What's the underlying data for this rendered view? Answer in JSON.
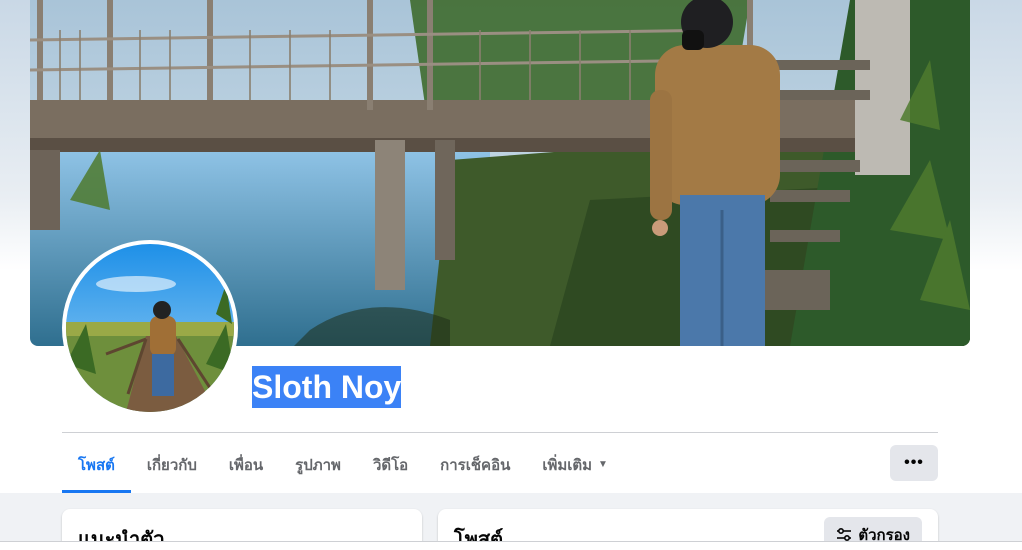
{
  "profile": {
    "name": "Sloth Noy"
  },
  "tabs": [
    {
      "label": "โพสต์",
      "active": true
    },
    {
      "label": "เกี่ยวกับ"
    },
    {
      "label": "เพื่อน"
    },
    {
      "label": "รูปภาพ"
    },
    {
      "label": "วิดีโอ"
    },
    {
      "label": "การเช็คอิน"
    },
    {
      "label": "เพิ่มเติม",
      "icon": "caret-down-icon"
    }
  ],
  "more_button": {
    "label": "•••",
    "icon": "more-icon"
  },
  "intro_card": {
    "title": "แนะนำตัว"
  },
  "posts_card": {
    "title": "โพสต์",
    "filter_label": "ตัวกรอง",
    "filter_icon": "filter-icon"
  },
  "colors": {
    "accent": "#1877f2",
    "name_highlight": "#3b82f6"
  }
}
